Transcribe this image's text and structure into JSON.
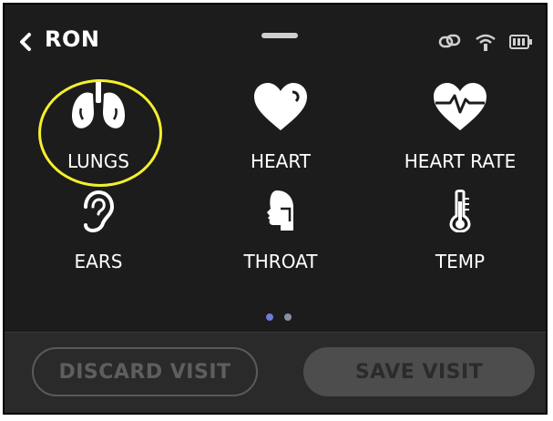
{
  "header": {
    "title": "RON",
    "back_icon": "chevron-left-icon",
    "status_icons": [
      "link-icon",
      "wifi-icon",
      "battery-icon"
    ]
  },
  "exams": [
    {
      "label": "LUNGS",
      "icon": "lungs-icon",
      "selected": true
    },
    {
      "label": "HEART",
      "icon": "heart-icon",
      "selected": false
    },
    {
      "label": "HEART RATE",
      "icon": "heart-rate-icon",
      "selected": false
    },
    {
      "label": "EARS",
      "icon": "ear-icon",
      "selected": false
    },
    {
      "label": "THROAT",
      "icon": "throat-icon",
      "selected": false
    },
    {
      "label": "TEMP",
      "icon": "thermometer-icon",
      "selected": false
    }
  ],
  "pagination": {
    "pages": 2,
    "current": 1
  },
  "footer": {
    "discard_label": "DISCARD VISIT",
    "save_label": "SAVE VISIT"
  },
  "colors": {
    "background": "#1c1c1c",
    "highlight": "#f5ef2e",
    "dot_active": "#6f7bd6",
    "dot_inactive": "#8a8f9c"
  }
}
